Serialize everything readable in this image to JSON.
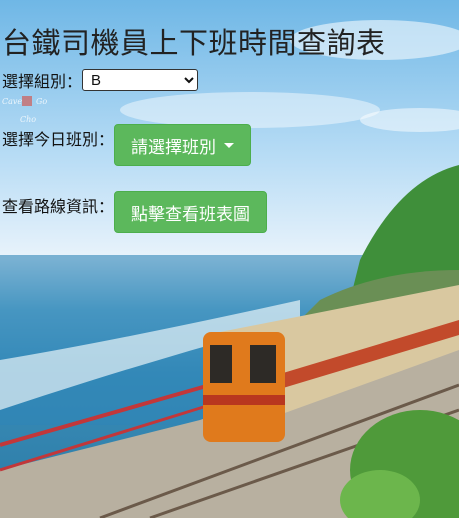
{
  "title": "台鐵司機員上下班時間查詢表",
  "group": {
    "label": "選擇組別：",
    "selected": "B"
  },
  "shift": {
    "label": "選擇今日班別：",
    "button": "請選擇班別"
  },
  "route": {
    "label": "查看路線資訊：",
    "button": "點擊查看班表圖"
  },
  "colors": {
    "button": "#5cb85c"
  }
}
